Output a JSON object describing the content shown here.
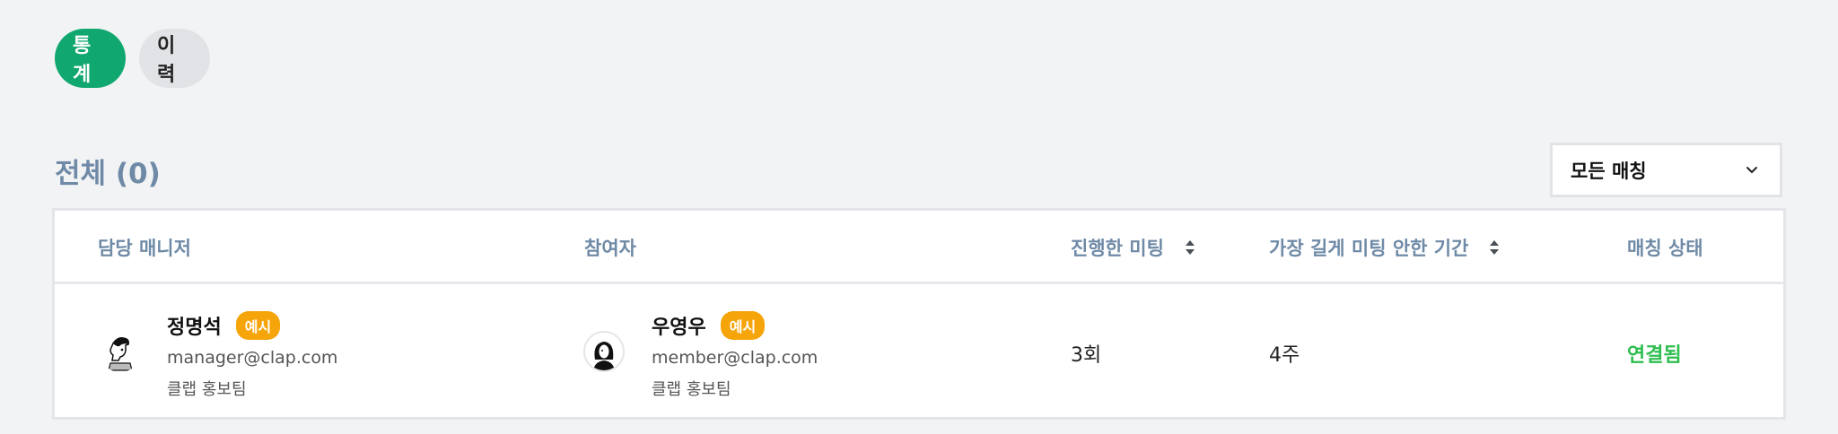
{
  "tabs": [
    {
      "label": "통계",
      "active": true
    },
    {
      "label": "이력",
      "active": false
    }
  ],
  "section": {
    "title": "전체 (0)"
  },
  "filter": {
    "selected": "모든 매칭"
  },
  "table": {
    "columns": {
      "manager": "담당 매니저",
      "participant": "참여자",
      "meetings": "진행한 미팅",
      "longest_gap": "가장 길게 미팅 안한 기간",
      "status": "매칭 상태"
    },
    "rows": [
      {
        "manager": {
          "name": "정명석",
          "badge": "예시",
          "email": "manager@clap.com",
          "team": "클랩 홍보팀"
        },
        "participant": {
          "name": "우영우",
          "badge": "예시",
          "email": "member@clap.com",
          "team": "클랩 홍보팀"
        },
        "meetings": "3회",
        "longest_gap": "4주",
        "status": "연결됨"
      }
    ]
  },
  "colors": {
    "accent": "#11a86f",
    "badge": "#f5a40a",
    "status_connected": "#2ebd4f",
    "header_text": "#6f8aa6"
  }
}
